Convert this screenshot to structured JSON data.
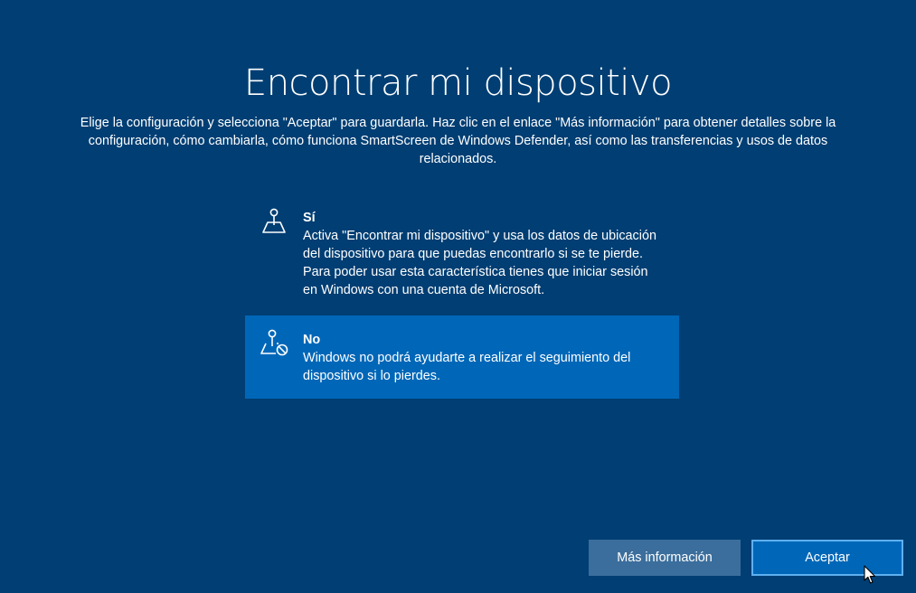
{
  "page": {
    "title": "Encontrar mi dispositivo",
    "description": "Elige la configuración y selecciona \"Aceptar\" para guardarla. Haz clic en el enlace \"Más información\" para obtener detalles sobre la configuración, cómo cambiarla, cómo funciona SmartScreen de Windows Defender, así como las transferencias y usos de datos relacionados."
  },
  "options": [
    {
      "id": "yes",
      "title": "Sí",
      "description": "Activa \"Encontrar mi dispositivo\" y usa los datos de ubicación del dispositivo para que puedas encontrarlo si se te pierde. Para poder usar esta característica tienes que iniciar sesión en Windows con una cuenta de Microsoft.",
      "icon": "location-map-icon",
      "selected": false
    },
    {
      "id": "no",
      "title": "No",
      "description": "Windows no podrá ayudarte a realizar el seguimiento del dispositivo si lo pierdes.",
      "icon": "location-map-blocked-icon",
      "selected": true
    }
  ],
  "buttons": {
    "more_info": "Más información",
    "accept": "Aceptar"
  },
  "colors": {
    "background": "#003e73",
    "selected_option": "#0067b8",
    "secondary_button": "#3b6e9c",
    "primary_button": "#0067b8",
    "primary_button_border": "#5fb0f0"
  }
}
